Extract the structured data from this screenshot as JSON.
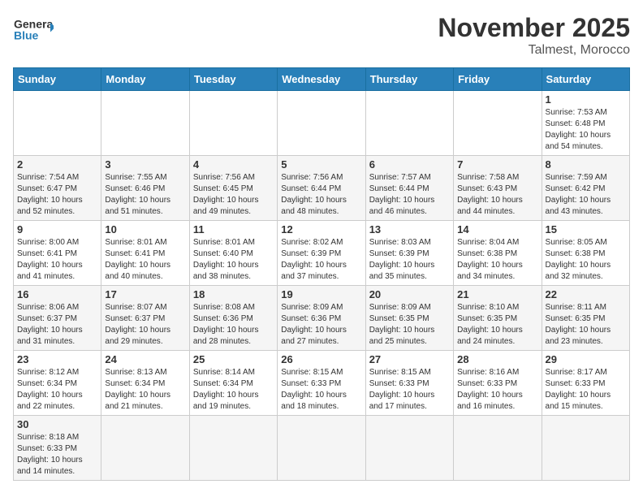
{
  "header": {
    "logo_general": "General",
    "logo_blue": "Blue",
    "month_title": "November 2025",
    "subtitle": "Talmest, Morocco"
  },
  "weekdays": [
    "Sunday",
    "Monday",
    "Tuesday",
    "Wednesday",
    "Thursday",
    "Friday",
    "Saturday"
  ],
  "days": {
    "d1": {
      "num": "1",
      "rise": "7:53 AM",
      "set": "6:48 PM",
      "hours": "10 hours",
      "minutes": "54 minutes"
    },
    "d2": {
      "num": "2",
      "rise": "7:54 AM",
      "set": "6:47 PM",
      "hours": "10 hours",
      "minutes": "52 minutes"
    },
    "d3": {
      "num": "3",
      "rise": "7:55 AM",
      "set": "6:46 PM",
      "hours": "10 hours",
      "minutes": "51 minutes"
    },
    "d4": {
      "num": "4",
      "rise": "7:56 AM",
      "set": "6:45 PM",
      "hours": "10 hours",
      "minutes": "49 minutes"
    },
    "d5": {
      "num": "5",
      "rise": "7:56 AM",
      "set": "6:44 PM",
      "hours": "10 hours",
      "minutes": "48 minutes"
    },
    "d6": {
      "num": "6",
      "rise": "7:57 AM",
      "set": "6:44 PM",
      "hours": "10 hours",
      "minutes": "46 minutes"
    },
    "d7": {
      "num": "7",
      "rise": "7:58 AM",
      "set": "6:43 PM",
      "hours": "10 hours",
      "minutes": "44 minutes"
    },
    "d8": {
      "num": "8",
      "rise": "7:59 AM",
      "set": "6:42 PM",
      "hours": "10 hours",
      "minutes": "43 minutes"
    },
    "d9": {
      "num": "9",
      "rise": "8:00 AM",
      "set": "6:41 PM",
      "hours": "10 hours",
      "minutes": "41 minutes"
    },
    "d10": {
      "num": "10",
      "rise": "8:01 AM",
      "set": "6:41 PM",
      "hours": "10 hours",
      "minutes": "40 minutes"
    },
    "d11": {
      "num": "11",
      "rise": "8:01 AM",
      "set": "6:40 PM",
      "hours": "10 hours",
      "minutes": "38 minutes"
    },
    "d12": {
      "num": "12",
      "rise": "8:02 AM",
      "set": "6:39 PM",
      "hours": "10 hours",
      "minutes": "37 minutes"
    },
    "d13": {
      "num": "13",
      "rise": "8:03 AM",
      "set": "6:39 PM",
      "hours": "10 hours",
      "minutes": "35 minutes"
    },
    "d14": {
      "num": "14",
      "rise": "8:04 AM",
      "set": "6:38 PM",
      "hours": "10 hours",
      "minutes": "34 minutes"
    },
    "d15": {
      "num": "15",
      "rise": "8:05 AM",
      "set": "6:38 PM",
      "hours": "10 hours",
      "minutes": "32 minutes"
    },
    "d16": {
      "num": "16",
      "rise": "8:06 AM",
      "set": "6:37 PM",
      "hours": "10 hours",
      "minutes": "31 minutes"
    },
    "d17": {
      "num": "17",
      "rise": "8:07 AM",
      "set": "6:37 PM",
      "hours": "10 hours",
      "minutes": "29 minutes"
    },
    "d18": {
      "num": "18",
      "rise": "8:08 AM",
      "set": "6:36 PM",
      "hours": "10 hours",
      "minutes": "28 minutes"
    },
    "d19": {
      "num": "19",
      "rise": "8:09 AM",
      "set": "6:36 PM",
      "hours": "10 hours",
      "minutes": "27 minutes"
    },
    "d20": {
      "num": "20",
      "rise": "8:09 AM",
      "set": "6:35 PM",
      "hours": "10 hours",
      "minutes": "25 minutes"
    },
    "d21": {
      "num": "21",
      "rise": "8:10 AM",
      "set": "6:35 PM",
      "hours": "10 hours",
      "minutes": "24 minutes"
    },
    "d22": {
      "num": "22",
      "rise": "8:11 AM",
      "set": "6:35 PM",
      "hours": "10 hours",
      "minutes": "23 minutes"
    },
    "d23": {
      "num": "23",
      "rise": "8:12 AM",
      "set": "6:34 PM",
      "hours": "10 hours",
      "minutes": "22 minutes"
    },
    "d24": {
      "num": "24",
      "rise": "8:13 AM",
      "set": "6:34 PM",
      "hours": "10 hours",
      "minutes": "21 minutes"
    },
    "d25": {
      "num": "25",
      "rise": "8:14 AM",
      "set": "6:34 PM",
      "hours": "10 hours",
      "minutes": "19 minutes"
    },
    "d26": {
      "num": "26",
      "rise": "8:15 AM",
      "set": "6:33 PM",
      "hours": "10 hours",
      "minutes": "18 minutes"
    },
    "d27": {
      "num": "27",
      "rise": "8:15 AM",
      "set": "6:33 PM",
      "hours": "10 hours",
      "minutes": "17 minutes"
    },
    "d28": {
      "num": "28",
      "rise": "8:16 AM",
      "set": "6:33 PM",
      "hours": "10 hours",
      "minutes": "16 minutes"
    },
    "d29": {
      "num": "29",
      "rise": "8:17 AM",
      "set": "6:33 PM",
      "hours": "10 hours",
      "minutes": "15 minutes"
    },
    "d30": {
      "num": "30",
      "rise": "8:18 AM",
      "set": "6:33 PM",
      "hours": "10 hours",
      "minutes": "14 minutes"
    }
  },
  "labels": {
    "sunrise": "Sunrise:",
    "sunset": "Sunset:",
    "daylight": "Daylight:",
    "and": "and"
  }
}
